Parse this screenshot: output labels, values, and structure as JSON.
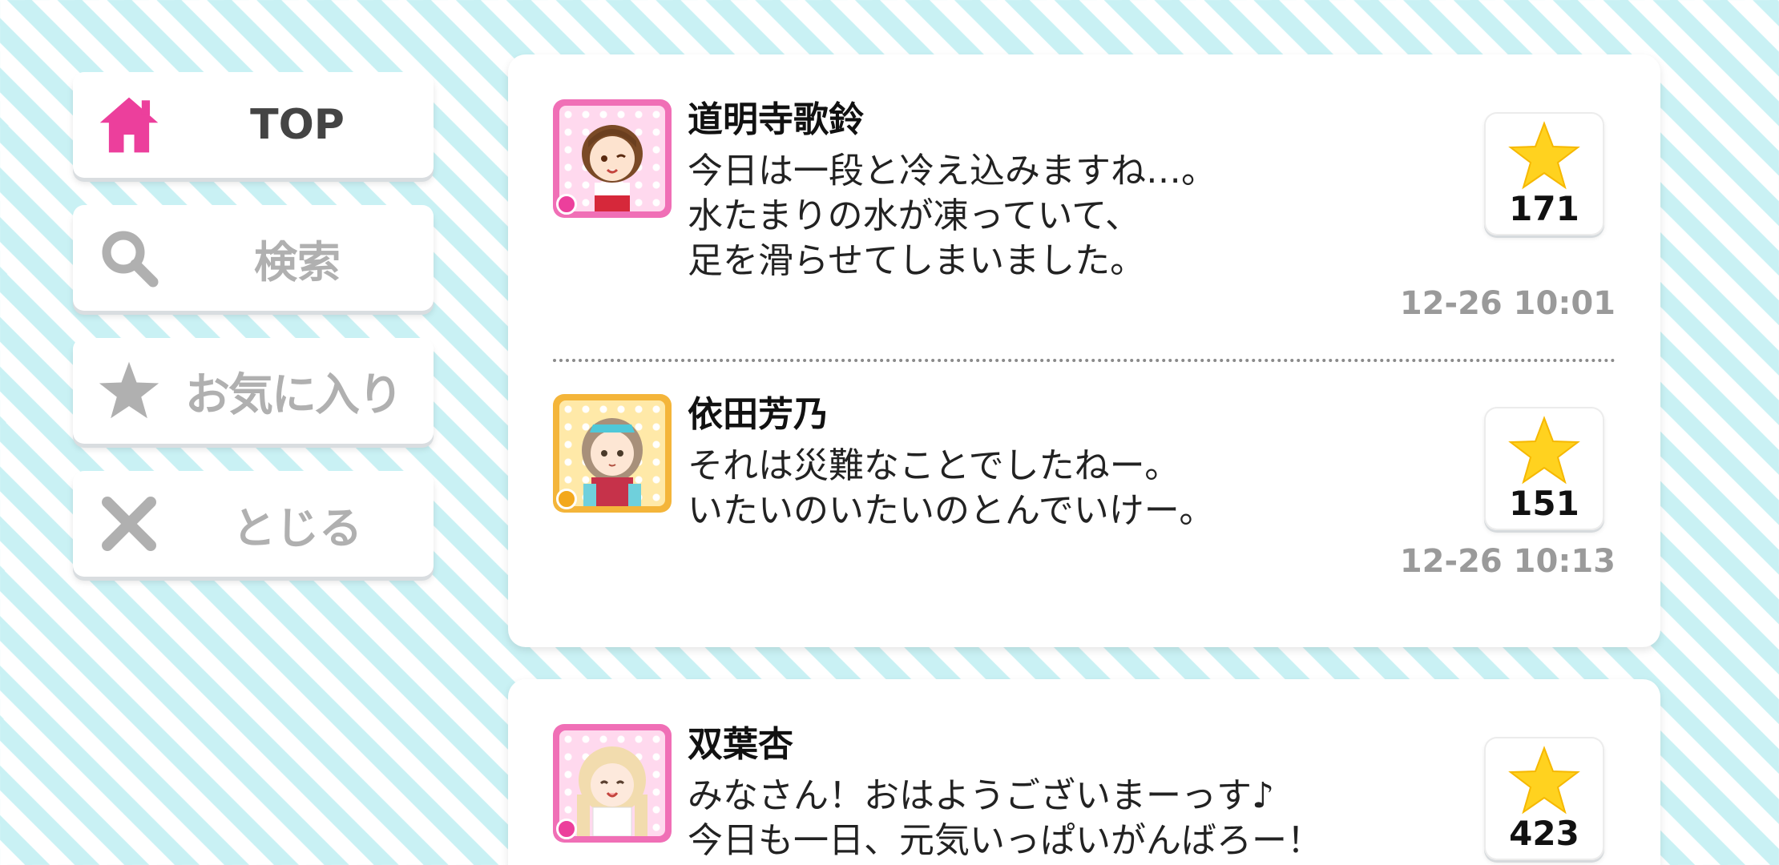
{
  "nav": {
    "top": {
      "label": "TOP",
      "icon": "home-icon"
    },
    "search": {
      "label": "検索",
      "icon": "search-icon"
    },
    "favorites": {
      "label": "お気に入り",
      "icon": "star-icon"
    },
    "close": {
      "label": "とじる",
      "icon": "close-icon"
    }
  },
  "colors": {
    "accent": "#ec3f9c",
    "inactive": "#b0b0b0",
    "star": "#ffd21f",
    "stripe": "#c9f1f4"
  },
  "posts": [
    {
      "name": "道明寺歌鈴",
      "lines": [
        "今日は一段と冷え込みますね…。",
        "水たまりの水が凍っていて、",
        "足を滑らせてしまいました。"
      ],
      "likes": "171",
      "time": "12-26 10:01"
    },
    {
      "name": "依田芳乃",
      "lines": [
        "それは災難なことでしたねー。",
        "いたいのいたいのとんでいけー。"
      ],
      "likes": "151",
      "time": "12-26 10:13"
    },
    {
      "name": "双葉杏",
      "lines": [
        "みなさん！おはようございまーっす♪",
        "今日も一日、元気いっぱいがんばろー！"
      ],
      "likes": "423",
      "time": ""
    }
  ]
}
